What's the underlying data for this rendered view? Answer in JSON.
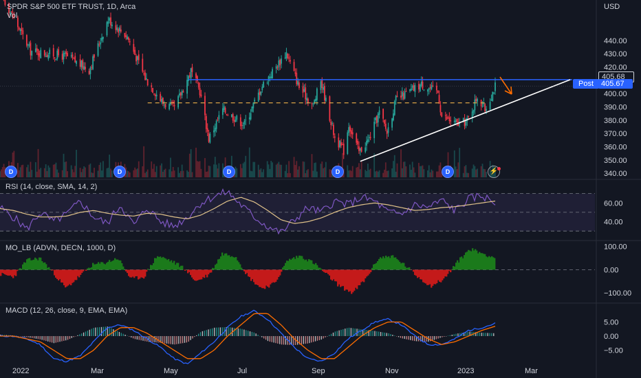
{
  "header": {
    "symbol_line": "SPDR S&P 500 ETF TRUST, 1D, Arca",
    "vol_label": "Vol",
    "currency": "USD"
  },
  "price_tags": {
    "last": "405.68",
    "post_label": "Post",
    "post_value": "405.67"
  },
  "badges": [
    "D",
    "D",
    "D",
    "D",
    "D",
    "D"
  ],
  "flash_icon": "lightning-icon",
  "colors": {
    "background": "#131722",
    "up": "#26a69a",
    "down": "#f23645",
    "resistance_line": "#2962ff",
    "support_dashed": "#f0b34a",
    "trendline": "#ffffff",
    "rsi_line": "#7e57c2",
    "rsi_sma": "#e0c28a",
    "macd_line": "#2962ff",
    "signal_line": "#ff6d00",
    "arrow": "#ff6d00"
  },
  "panes": {
    "rsi": {
      "label": "RSI (14, close, SMA, 14, 2)",
      "ticks": [
        "60.00",
        "40.00"
      ]
    },
    "mo": {
      "label": "MO_LB (ADVN, DECN, 1000, D)",
      "ticks": [
        "100.00",
        "0.00",
        "−100.00"
      ]
    },
    "macd": {
      "label": "MACD (12, 26, close, 9, EMA, EMA)",
      "ticks": [
        "5.00",
        "0.00",
        "−5.00"
      ]
    }
  },
  "chart_data": [
    {
      "type": "candlestick",
      "title": "SPDR S&P 500 ETF TRUST, 1D, Arca",
      "y_unit": "USD",
      "y_ticks": [
        440,
        430,
        420,
        410,
        400,
        390,
        380,
        370,
        360,
        350,
        340
      ],
      "ylim": [
        337,
        458
      ],
      "x_ticks": [
        "2022",
        "Mar",
        "May",
        "Jul",
        "Sep",
        "Nov",
        "2023",
        "Mar"
      ],
      "last_price": 405.68,
      "post_price": 405.67,
      "key_points": [
        {
          "date": "2022-01-03",
          "close": 477
        },
        {
          "date": "2022-01-27",
          "close": 432
        },
        {
          "date": "2022-02-24",
          "close": 428
        },
        {
          "date": "2022-03-14",
          "close": 418
        },
        {
          "date": "2022-03-29",
          "close": 456
        },
        {
          "date": "2022-04-13",
          "close": 443
        },
        {
          "date": "2022-04-27",
          "close": 412
        },
        {
          "date": "2022-05-11",
          "close": 393
        },
        {
          "date": "2022-05-20",
          "close": 389
        },
        {
          "date": "2022-06-02",
          "close": 417
        },
        {
          "date": "2022-06-09",
          "close": 402
        },
        {
          "date": "2022-06-16",
          "close": 366
        },
        {
          "date": "2022-06-27",
          "close": 388
        },
        {
          "date": "2022-07-14",
          "close": 377
        },
        {
          "date": "2022-07-28",
          "close": 406
        },
        {
          "date": "2022-08-16",
          "close": 431
        },
        {
          "date": "2022-08-26",
          "close": 405
        },
        {
          "date": "2022-09-06",
          "close": 391
        },
        {
          "date": "2022-09-12",
          "close": 410
        },
        {
          "date": "2022-09-23",
          "close": 367
        },
        {
          "date": "2022-09-30",
          "close": 357
        },
        {
          "date": "2022-10-04",
          "close": 377
        },
        {
          "date": "2022-10-12",
          "close": 356
        },
        {
          "date": "2022-10-20",
          "close": 366
        },
        {
          "date": "2022-10-28",
          "close": 386
        },
        {
          "date": "2022-11-03",
          "close": 371
        },
        {
          "date": "2022-11-10",
          "close": 395
        },
        {
          "date": "2022-11-30",
          "close": 407
        },
        {
          "date": "2022-12-13",
          "close": 401
        },
        {
          "date": "2022-12-16",
          "close": 383
        },
        {
          "date": "2022-12-28",
          "close": 377
        },
        {
          "date": "2023-01-05",
          "close": 379
        },
        {
          "date": "2023-01-13",
          "close": 398
        },
        {
          "date": "2023-01-19",
          "close": 388
        },
        {
          "date": "2023-01-27",
          "close": 405.68
        }
      ],
      "annotations": {
        "resistance": 410.5,
        "dashed_support": 393,
        "trendline": [
          {
            "date": "2022-10-13",
            "value": 349
          },
          {
            "date": "2023-03-27",
            "value": 410.5
          }
        ]
      }
    },
    {
      "type": "line",
      "title": "RSI (14, close, SMA, 14, 2)",
      "ylim": [
        25,
        80
      ],
      "y_ticks": [
        60,
        40
      ],
      "bands": [
        70,
        50,
        30
      ],
      "series": [
        {
          "name": "RSI",
          "values": [
            55,
            45,
            32,
            50,
            40,
            48,
            62,
            45,
            38,
            58,
            36,
            55,
            40,
            35,
            45,
            60,
            67,
            72,
            58,
            45,
            35,
            28,
            42,
            55,
            50,
            62,
            58,
            66,
            62,
            50,
            48,
            58,
            55,
            63,
            52,
            64,
            68,
            60
          ]
        },
        {
          "name": "SMA",
          "values": [
            54,
            52,
            48,
            45,
            45,
            46,
            50,
            52,
            49,
            47,
            46,
            49,
            48,
            45,
            43,
            47,
            54,
            62,
            66,
            61,
            52,
            42,
            38,
            40,
            44,
            50,
            55,
            58,
            60,
            58,
            55,
            52,
            53,
            55,
            56,
            58,
            60,
            62
          ]
        }
      ]
    },
    {
      "type": "area",
      "title": "MO_LB (ADVN, DECN, 1000, D)",
      "ylim": [
        -135,
        120
      ],
      "y_ticks": [
        100,
        0,
        -100
      ],
      "values": [
        -20,
        -30,
        40,
        50,
        -10,
        -80,
        -30,
        20,
        30,
        50,
        -40,
        -30,
        60,
        40,
        10,
        -50,
        -20,
        70,
        60,
        -30,
        -80,
        -60,
        40,
        60,
        30,
        -20,
        -70,
        -100,
        -40,
        50,
        60,
        20,
        -30,
        -70,
        -40,
        30,
        90,
        70,
        50
      ]
    },
    {
      "type": "line",
      "title": "MACD (12, 26, close, 9, EMA, EMA)",
      "ylim": [
        -10,
        10.5
      ],
      "y_ticks": [
        5,
        0,
        -5
      ],
      "series": [
        {
          "name": "MACD",
          "values": [
            0,
            0,
            -1,
            -3,
            -8,
            -9,
            -7,
            -2,
            3,
            4,
            2,
            -1,
            -4,
            -8,
            -10,
            -6,
            -2,
            3,
            7,
            9,
            6,
            1,
            -4,
            -8,
            -9,
            -6,
            -1,
            2,
            5,
            6,
            4,
            0,
            -3,
            -3,
            -1,
            2,
            3,
            4.5
          ]
        },
        {
          "name": "Signal",
          "values": [
            0,
            0,
            -1,
            -2,
            -5,
            -8,
            -8,
            -5,
            0,
            3,
            3,
            1,
            -2,
            -5,
            -8,
            -8,
            -5,
            0,
            4,
            8,
            8,
            4,
            -1,
            -5,
            -8,
            -8,
            -4,
            0,
            3,
            5,
            5,
            2,
            -1,
            -3,
            -2,
            0,
            2,
            3.5
          ]
        }
      ],
      "histogram": [
        0.5,
        0.2,
        -0.4,
        -1.2,
        -2.5,
        -1.4,
        0.8,
        3,
        3.4,
        1.2,
        -1,
        -2,
        -2.4,
        -3,
        -2.2,
        1.6,
        3,
        3.2,
        2.6,
        1.2,
        -1.8,
        -3,
        -3.2,
        -2.6,
        -1.2,
        1.6,
        3,
        2.4,
        1.8,
        1,
        -0.8,
        -1.8,
        -2,
        -0.4,
        0.8,
        1.6,
        1.2,
        1
      ]
    }
  ]
}
